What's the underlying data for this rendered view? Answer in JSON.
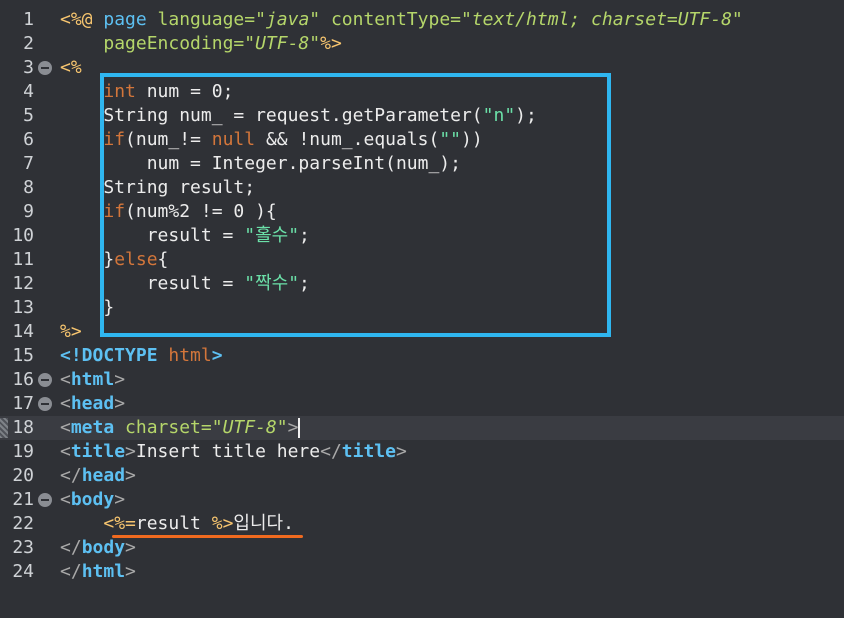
{
  "editor": {
    "lines": [
      {
        "n": "1",
        "segments": [
          [
            "t-delim",
            "<%@ "
          ],
          [
            "t-kw",
            "page "
          ],
          [
            "t-attr",
            "language="
          ],
          [
            "t-val",
            "\"java\" "
          ],
          [
            "t-attr",
            "contentType="
          ],
          [
            "t-val",
            "\"text/html; charset=UTF-8\""
          ]
        ]
      },
      {
        "n": "2",
        "segments": [
          [
            "t-plain",
            "    "
          ],
          [
            "t-attr",
            "pageEncoding="
          ],
          [
            "t-val",
            "\"UTF-8\""
          ],
          [
            "t-delim",
            "%>"
          ]
        ]
      },
      {
        "n": "3",
        "fold": true,
        "segments": [
          [
            "t-delim",
            "<%"
          ]
        ]
      },
      {
        "n": "4",
        "segments": [
          [
            "t-plain",
            "    "
          ],
          [
            "t-jkw",
            "int "
          ],
          [
            "t-plain",
            "num = 0;"
          ]
        ]
      },
      {
        "n": "5",
        "segments": [
          [
            "t-plain",
            "    String num_ = request.getParameter("
          ],
          [
            "t-str",
            "\"n\""
          ],
          [
            "t-plain",
            ");"
          ]
        ]
      },
      {
        "n": "6",
        "segments": [
          [
            "t-plain",
            "    "
          ],
          [
            "t-jkw",
            "if"
          ],
          [
            "t-plain",
            "(num_!= "
          ],
          [
            "t-jkw",
            "null"
          ],
          [
            "t-plain",
            " && !num_.equals("
          ],
          [
            "t-str",
            "\"\""
          ],
          [
            "t-plain",
            "))"
          ]
        ]
      },
      {
        "n": "7",
        "segments": [
          [
            "t-plain",
            "        num = Integer.parseInt(num_);"
          ]
        ]
      },
      {
        "n": "8",
        "segments": [
          [
            "t-plain",
            "    String result;"
          ]
        ]
      },
      {
        "n": "9",
        "segments": [
          [
            "t-plain",
            "    "
          ],
          [
            "t-jkw",
            "if"
          ],
          [
            "t-plain",
            "(num%2 != 0 ){"
          ]
        ]
      },
      {
        "n": "10",
        "segments": [
          [
            "t-plain",
            "        result = "
          ],
          [
            "t-str",
            "\"홀수\""
          ],
          [
            "t-plain",
            ";"
          ]
        ]
      },
      {
        "n": "11",
        "segments": [
          [
            "t-plain",
            "    }"
          ],
          [
            "t-jkw",
            "else"
          ],
          [
            "t-plain",
            "{"
          ]
        ]
      },
      {
        "n": "12",
        "segments": [
          [
            "t-plain",
            "        result = "
          ],
          [
            "t-str",
            "\"짝수\""
          ],
          [
            "t-plain",
            ";"
          ]
        ]
      },
      {
        "n": "13",
        "segments": [
          [
            "t-plain",
            "    }"
          ]
        ]
      },
      {
        "n": "14",
        "segments": [
          [
            "t-delim",
            "%>"
          ]
        ]
      },
      {
        "n": "15",
        "segments": [
          [
            "t-doc",
            "<!DOCTYPE "
          ],
          [
            "t-dochtml",
            "html"
          ],
          [
            "t-doc",
            ">"
          ]
        ]
      },
      {
        "n": "16",
        "fold": true,
        "segments": [
          [
            "t-tagb",
            "<"
          ],
          [
            "t-tag",
            "html"
          ],
          [
            "t-tagb",
            ">"
          ]
        ]
      },
      {
        "n": "17",
        "fold": true,
        "segments": [
          [
            "t-tagb",
            "<"
          ],
          [
            "t-tag",
            "head"
          ],
          [
            "t-tagb",
            ">"
          ]
        ]
      },
      {
        "n": "18",
        "current": true,
        "marker": true,
        "segments": [
          [
            "t-tagb",
            "<"
          ],
          [
            "t-tag",
            "meta "
          ],
          [
            "t-attr",
            "charset="
          ],
          [
            "t-val",
            "\"UTF-8\""
          ],
          [
            "t-tagb",
            ">"
          ]
        ]
      },
      {
        "n": "19",
        "segments": [
          [
            "t-tagb",
            "<"
          ],
          [
            "t-tag",
            "title"
          ],
          [
            "t-tagb",
            ">"
          ],
          [
            "t-plain",
            "Insert title here"
          ],
          [
            "t-tagb",
            "</"
          ],
          [
            "t-tag",
            "title"
          ],
          [
            "t-tagb",
            ">"
          ]
        ]
      },
      {
        "n": "20",
        "segments": [
          [
            "t-tagb",
            "</"
          ],
          [
            "t-tag",
            "head"
          ],
          [
            "t-tagb",
            ">"
          ]
        ]
      },
      {
        "n": "21",
        "fold": true,
        "segments": [
          [
            "t-tagb",
            "<"
          ],
          [
            "t-tag",
            "body"
          ],
          [
            "t-tagb",
            ">"
          ]
        ]
      },
      {
        "n": "22",
        "segments": [
          [
            "t-plain",
            "    "
          ],
          [
            "t-delim",
            "<%="
          ],
          [
            "t-plain",
            "result "
          ],
          [
            "t-delim",
            "%>"
          ],
          [
            "t-plain",
            "입니다."
          ]
        ]
      },
      {
        "n": "23",
        "segments": [
          [
            "t-tagb",
            "</"
          ],
          [
            "t-tag",
            "body"
          ],
          [
            "t-tagb",
            ">"
          ]
        ]
      },
      {
        "n": "24",
        "segments": [
          [
            "t-tagb",
            "</"
          ],
          [
            "t-tag",
            "html"
          ],
          [
            "t-tagb",
            ">"
          ]
        ]
      }
    ]
  },
  "annotations": {
    "box_color": "#2fb6f0",
    "underline_color": "#f06a1f"
  }
}
